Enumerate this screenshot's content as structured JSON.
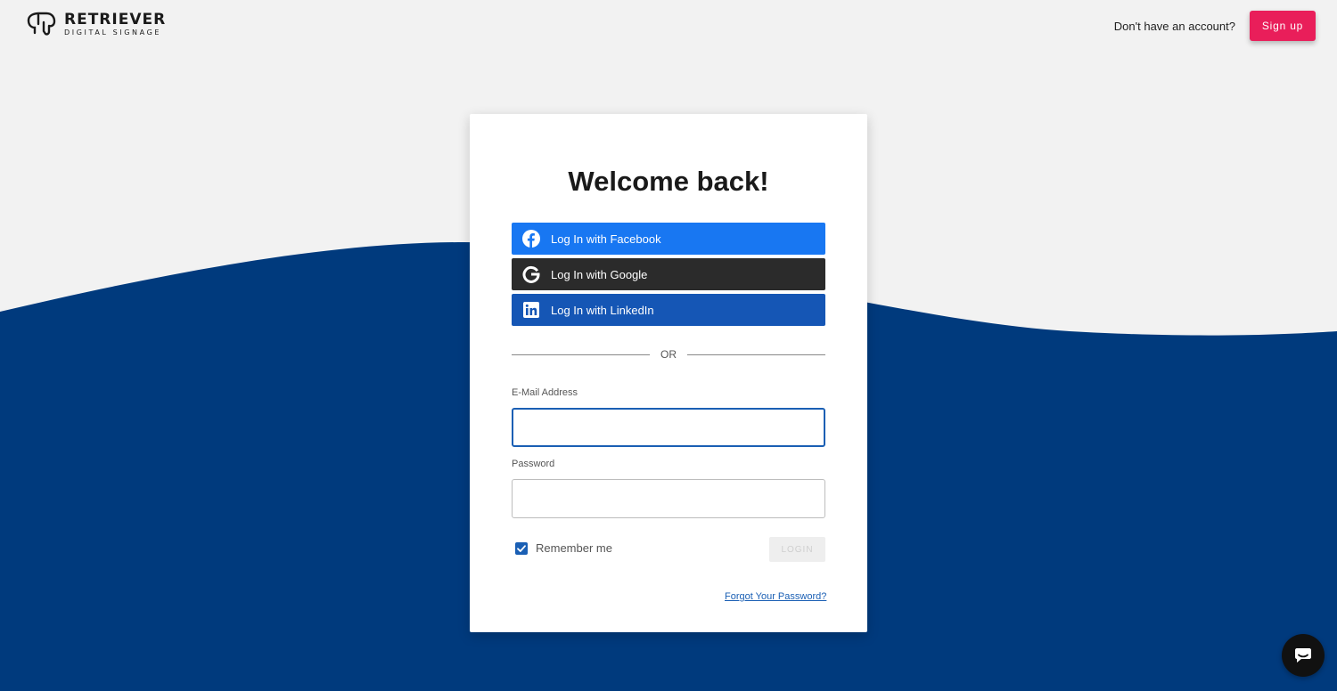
{
  "brand": {
    "name": "RETRIEVER",
    "tagline": "DIGITAL SIGNAGE"
  },
  "header": {
    "no_account_text": "Don't have an account?",
    "signup_label": "Sign up"
  },
  "login_card": {
    "title": "Welcome back!",
    "social": {
      "facebook_label": "Log In with Facebook",
      "google_label": "Log In with Google",
      "linkedin_label": "Log In with LinkedIn"
    },
    "divider_text": "OR",
    "email": {
      "label": "E-Mail Address",
      "value": ""
    },
    "password": {
      "label": "Password",
      "value": ""
    },
    "remember_me": {
      "label": "Remember me",
      "checked": true
    },
    "login_label": "LOGIN",
    "forgot_password_label": "Forgot Your Password?"
  },
  "icons": {
    "logo": "retriever-logo-icon",
    "facebook": "facebook-icon",
    "google": "google-icon",
    "linkedin": "linkedin-icon",
    "checkbox": "check-icon",
    "chat": "chat-icon"
  },
  "colors": {
    "background": "#f2f2f2",
    "wave": "#003a7d",
    "signup": "#e91e5a",
    "facebook": "#1877f2",
    "google": "#2b2b2b",
    "linkedin": "#1556b5",
    "accent": "#1a5fb4"
  }
}
